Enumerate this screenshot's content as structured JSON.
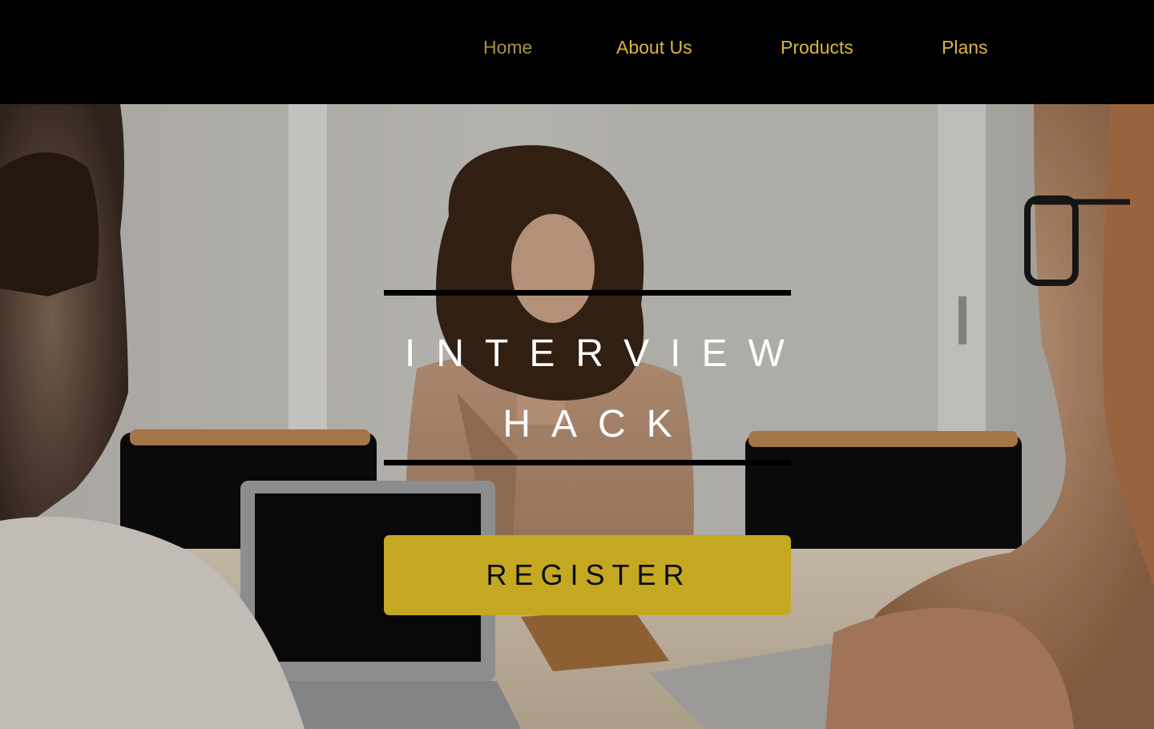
{
  "nav": {
    "items": [
      {
        "label": "Home",
        "active": true
      },
      {
        "label": "About Us",
        "active": false
      },
      {
        "label": "Products",
        "active": false
      },
      {
        "label": "Plans",
        "active": false
      }
    ]
  },
  "hero": {
    "title_line1": "INTERVIEW",
    "title_line2": "HACK",
    "cta_label": "REGISTER"
  },
  "colors": {
    "nav_background": "#000000",
    "nav_link": "#d8b83a",
    "nav_link_active": "#a8923f",
    "cta_background": "#c4a822",
    "headline_text": "#ffffff"
  }
}
